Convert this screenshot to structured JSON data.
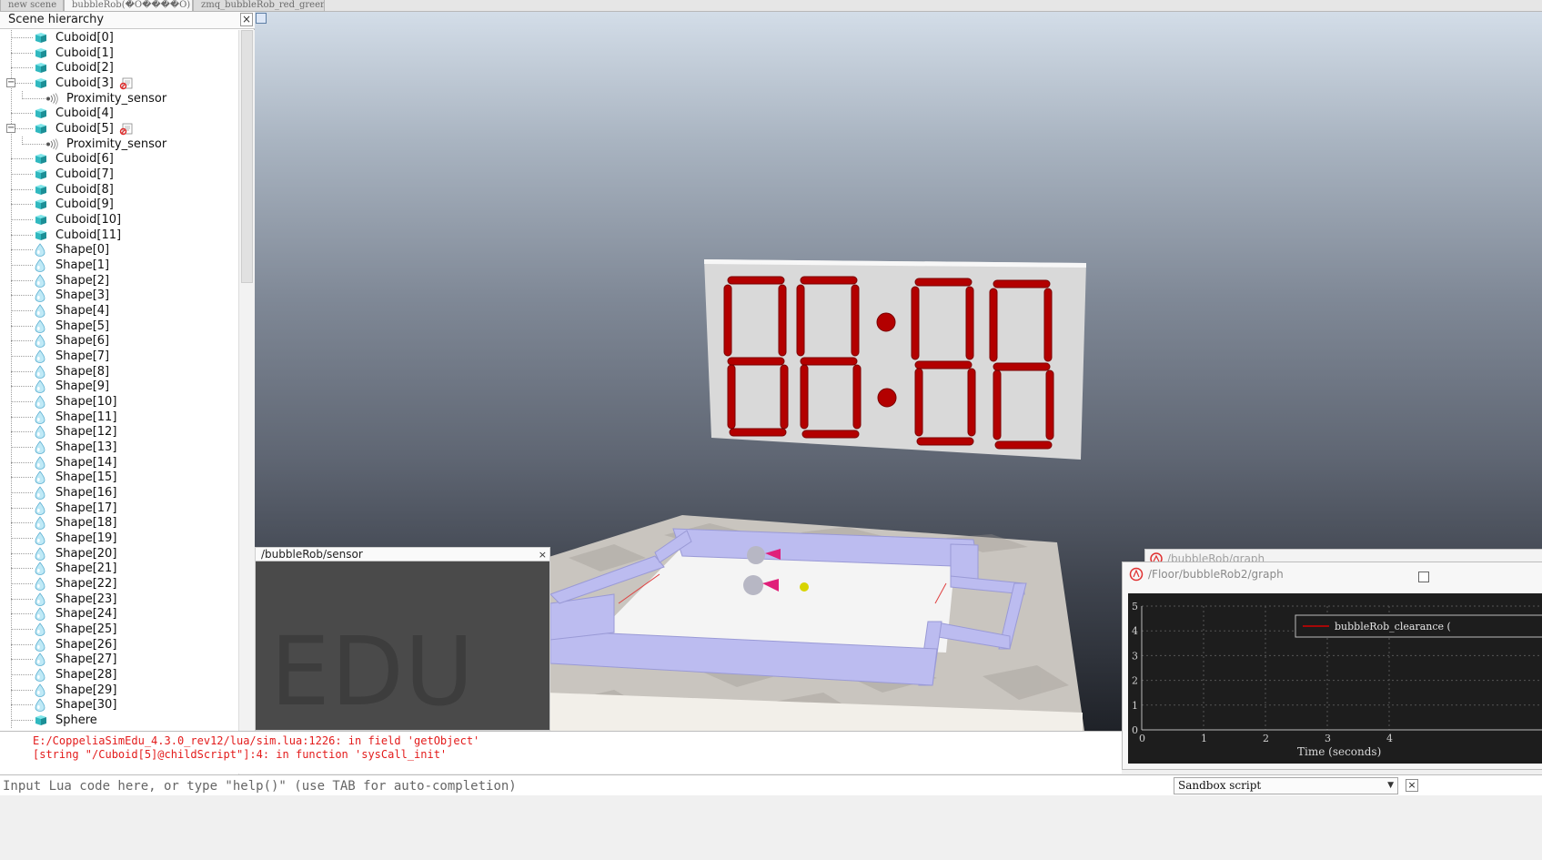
{
  "tabs": [
    "new scene",
    "bubbleRob(�O����O)",
    "zmq_bubbleRob_red_green"
  ],
  "hierarchy": {
    "title": "Scene hierarchy",
    "close": "×",
    "items": [
      {
        "label": "Cuboid[0]",
        "type": "cube",
        "depth": 0
      },
      {
        "label": "Cuboid[1]",
        "type": "cube",
        "depth": 0
      },
      {
        "label": "Cuboid[2]",
        "type": "cube",
        "depth": 0
      },
      {
        "label": "Cuboid[3]",
        "type": "cube",
        "depth": 0,
        "expander": "−",
        "script": true
      },
      {
        "label": "Proximity_sensor",
        "type": "sensor",
        "depth": 1
      },
      {
        "label": "Cuboid[4]",
        "type": "cube",
        "depth": 0
      },
      {
        "label": "Cuboid[5]",
        "type": "cube",
        "depth": 0,
        "expander": "−",
        "script": true
      },
      {
        "label": "Proximity_sensor",
        "type": "sensor",
        "depth": 1
      },
      {
        "label": "Cuboid[6]",
        "type": "cube",
        "depth": 0
      },
      {
        "label": "Cuboid[7]",
        "type": "cube",
        "depth": 0
      },
      {
        "label": "Cuboid[8]",
        "type": "cube",
        "depth": 0
      },
      {
        "label": "Cuboid[9]",
        "type": "cube",
        "depth": 0
      },
      {
        "label": "Cuboid[10]",
        "type": "cube",
        "depth": 0
      },
      {
        "label": "Cuboid[11]",
        "type": "cube",
        "depth": 0
      },
      {
        "label": "Shape[0]",
        "type": "shape",
        "depth": 0
      },
      {
        "label": "Shape[1]",
        "type": "shape",
        "depth": 0
      },
      {
        "label": "Shape[2]",
        "type": "shape",
        "depth": 0
      },
      {
        "label": "Shape[3]",
        "type": "shape",
        "depth": 0
      },
      {
        "label": "Shape[4]",
        "type": "shape",
        "depth": 0
      },
      {
        "label": "Shape[5]",
        "type": "shape",
        "depth": 0
      },
      {
        "label": "Shape[6]",
        "type": "shape",
        "depth": 0
      },
      {
        "label": "Shape[7]",
        "type": "shape",
        "depth": 0
      },
      {
        "label": "Shape[8]",
        "type": "shape",
        "depth": 0
      },
      {
        "label": "Shape[9]",
        "type": "shape",
        "depth": 0
      },
      {
        "label": "Shape[10]",
        "type": "shape",
        "depth": 0
      },
      {
        "label": "Shape[11]",
        "type": "shape",
        "depth": 0
      },
      {
        "label": "Shape[12]",
        "type": "shape",
        "depth": 0
      },
      {
        "label": "Shape[13]",
        "type": "shape",
        "depth": 0
      },
      {
        "label": "Shape[14]",
        "type": "shape",
        "depth": 0
      },
      {
        "label": "Shape[15]",
        "type": "shape",
        "depth": 0
      },
      {
        "label": "Shape[16]",
        "type": "shape",
        "depth": 0
      },
      {
        "label": "Shape[17]",
        "type": "shape",
        "depth": 0
      },
      {
        "label": "Shape[18]",
        "type": "shape",
        "depth": 0
      },
      {
        "label": "Shape[19]",
        "type": "shape",
        "depth": 0
      },
      {
        "label": "Shape[20]",
        "type": "shape",
        "depth": 0
      },
      {
        "label": "Shape[21]",
        "type": "shape",
        "depth": 0
      },
      {
        "label": "Shape[22]",
        "type": "shape",
        "depth": 0
      },
      {
        "label": "Shape[23]",
        "type": "shape",
        "depth": 0
      },
      {
        "label": "Shape[24]",
        "type": "shape",
        "depth": 0
      },
      {
        "label": "Shape[25]",
        "type": "shape",
        "depth": 0
      },
      {
        "label": "Shape[26]",
        "type": "shape",
        "depth": 0
      },
      {
        "label": "Shape[27]",
        "type": "shape",
        "depth": 0
      },
      {
        "label": "Shape[28]",
        "type": "shape",
        "depth": 0
      },
      {
        "label": "Shape[29]",
        "type": "shape",
        "depth": 0
      },
      {
        "label": "Shape[30]",
        "type": "shape",
        "depth": 0
      },
      {
        "label": "Sphere",
        "type": "cube",
        "depth": 0
      }
    ]
  },
  "sensor_window": {
    "title": "/bubbleRob/sensor",
    "close": "×",
    "watermark": "EDU"
  },
  "graph_window": {
    "back_title": "/bubbleRob/graph",
    "title": "/Floor/bubbleRob2/graph",
    "legend": "bubbleRob_clearance (",
    "xlabel": "Time (seconds)",
    "x_ticks": [
      "0",
      "1",
      "2",
      "3",
      "4"
    ],
    "y_ticks": [
      "0",
      "1",
      "2",
      "3",
      "4",
      "5"
    ]
  },
  "console": {
    "lines": [
      "E:/CoppeliaSimEdu_4.3.0_rev12/lua/sim.lua:1226: in field 'getObject'",
      "[string \"/Cuboid[5]@childScript\"]:4: in function 'sysCall_init'"
    ]
  },
  "lua": {
    "placeholder": "Input Lua code here, or type \"help()\" (use TAB for auto-completion)",
    "script_option": "Sandbox script",
    "close": "×"
  },
  "colors": {
    "clock_segment": "#b30000",
    "graph_bg": "#1d1d1d",
    "console_error": "#e31b1b",
    "legend_line": "#d40000"
  }
}
